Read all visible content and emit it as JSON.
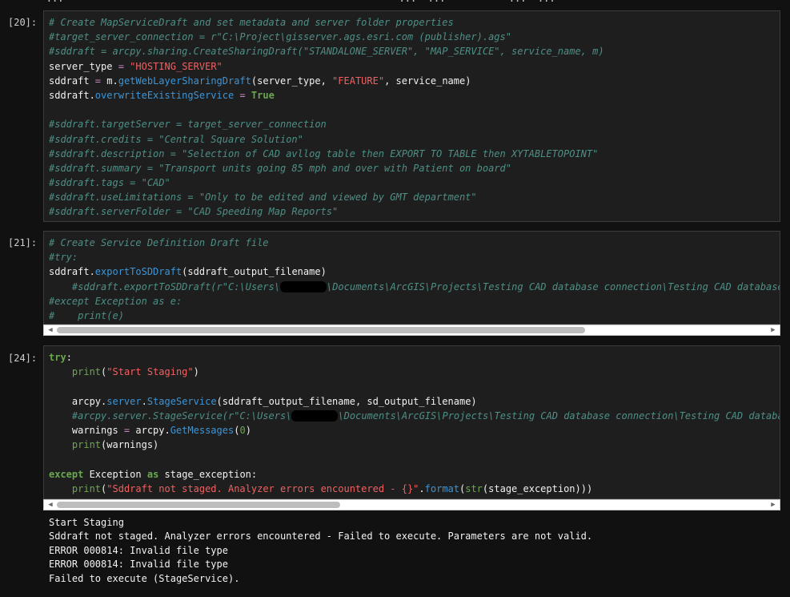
{
  "top_fragment": "        ...                                                          ...  ...           ...  ...",
  "cells": [
    {
      "prompt": "[20]:",
      "lines": [
        [
          [
            "cm",
            "# Create MapServiceDraft and set metadata and server folder properties"
          ]
        ],
        [
          [
            "cm",
            "#target_server_connection = r\"C:\\Project\\gisserver.ags.esri.com (publisher).ags\""
          ]
        ],
        [
          [
            "cm",
            "#sddraft = arcpy.sharing.CreateSharingDraft(\"STANDALONE_SERVER\", \"MAP_SERVICE\", service_name, m)"
          ]
        ],
        [
          [
            "var",
            "server_type "
          ],
          [
            "op",
            "="
          ],
          [
            "var",
            " "
          ],
          [
            "str",
            "\"HOSTING_SERVER\""
          ]
        ],
        [
          [
            "var",
            "sddraft "
          ],
          [
            "op",
            "="
          ],
          [
            "var",
            " m."
          ],
          [
            "fn",
            "getWebLayerSharingDraft"
          ],
          [
            "var",
            "(server_type, "
          ],
          [
            "str",
            "\"FEATURE\""
          ],
          [
            "var",
            ", service_name)"
          ]
        ],
        [
          [
            "var",
            "sddraft."
          ],
          [
            "fn",
            "overwriteExistingService"
          ],
          [
            "var",
            " "
          ],
          [
            "op",
            "="
          ],
          [
            "var",
            " "
          ],
          [
            "kw",
            "True"
          ]
        ],
        [
          [
            "var",
            ""
          ]
        ],
        [
          [
            "cm",
            "#sddraft.targetServer = target_server_connection"
          ]
        ],
        [
          [
            "cm",
            "#sddraft.credits = \"Central Square Solution\""
          ]
        ],
        [
          [
            "cm",
            "#sddraft.description = \"Selection of CAD avllog table then EXPORT TO TABLE then XYTABLETOPOINT\""
          ]
        ],
        [
          [
            "cm",
            "#sddraft.summary = \"Transport units going 85 mph and over with Patient on board\""
          ]
        ],
        [
          [
            "cm",
            "#sddraft.tags = \"CAD\""
          ]
        ],
        [
          [
            "cm",
            "#sddraft.useLimitations = \"Only to be edited and viewed by GMT department\""
          ]
        ],
        [
          [
            "cm",
            "#sddraft.serverFolder = \"CAD Speeding Map Reports\""
          ]
        ]
      ]
    },
    {
      "prompt": "[21]:",
      "lines": [
        [
          [
            "cm",
            "# Create Service Definition Draft file"
          ]
        ],
        [
          [
            "cm",
            "#try:"
          ]
        ],
        [
          [
            "var",
            "sddraft."
          ],
          [
            "fn",
            "exportToSDDraft"
          ],
          [
            "var",
            "(sddraft_output_filename)"
          ]
        ],
        [
          [
            "cm",
            "    #sddraft.exportToSDDraft(r\"C:\\Users\\"
          ],
          [
            "redact",
            ""
          ],
          [
            "cm",
            "\\Documents\\ArcGIS\\Projects\\Testing CAD database connection\\Testing CAD database c"
          ]
        ],
        [
          [
            "cm",
            "#except Exception as e:"
          ]
        ],
        [
          [
            "cm",
            "#    print(e)"
          ]
        ]
      ]
    },
    {
      "prompt": "[24]:",
      "lines": [
        [
          [
            "kw",
            "try"
          ],
          [
            "var",
            ":"
          ]
        ],
        [
          [
            "var",
            "    "
          ],
          [
            "bi",
            "print"
          ],
          [
            "var",
            "("
          ],
          [
            "str",
            "\"Start Staging\""
          ],
          [
            "var",
            ")"
          ]
        ],
        [
          [
            "var",
            ""
          ]
        ],
        [
          [
            "var",
            "    arcpy."
          ],
          [
            "fn",
            "server"
          ],
          [
            "var",
            "."
          ],
          [
            "fn",
            "StageService"
          ],
          [
            "var",
            "(sddraft_output_filename, sd_output_filename)"
          ]
        ],
        [
          [
            "cm",
            "    #arcpy.server.StageService(r\"C:\\Users\\"
          ],
          [
            "redact",
            ""
          ],
          [
            "cm",
            "\\Documents\\ArcGIS\\Projects\\Testing CAD database connection\\Testing CAD database"
          ]
        ],
        [
          [
            "var",
            "    warnings "
          ],
          [
            "op",
            "="
          ],
          [
            "var",
            " arcpy."
          ],
          [
            "fn",
            "GetMessages"
          ],
          [
            "var",
            "("
          ],
          [
            "num",
            "0"
          ],
          [
            "var",
            ")"
          ]
        ],
        [
          [
            "var",
            "    "
          ],
          [
            "bi",
            "print"
          ],
          [
            "var",
            "(warnings)"
          ]
        ],
        [
          [
            "var",
            ""
          ]
        ],
        [
          [
            "kw",
            "except"
          ],
          [
            "var",
            " Exception "
          ],
          [
            "kw",
            "as"
          ],
          [
            "var",
            " stage_exception:"
          ]
        ],
        [
          [
            "var",
            "    "
          ],
          [
            "bi",
            "print"
          ],
          [
            "var",
            "("
          ],
          [
            "str",
            "\"Sddraft not staged. Analyzer errors encountered - {}\""
          ],
          [
            "var",
            "."
          ],
          [
            "fn",
            "format"
          ],
          [
            "var",
            "("
          ],
          [
            "bi",
            "str"
          ],
          [
            "var",
            "(stage_exception)))"
          ]
        ]
      ]
    }
  ],
  "output_lines": [
    "Start Staging",
    "Sddraft not staged. Analyzer errors encountered - Failed to execute. Parameters are not valid.",
    "ERROR 000814: Invalid file type",
    "ERROR 000814: Invalid file type",
    "Failed to execute (StageService)."
  ],
  "colors": {
    "background": "#111111",
    "cell_background": "#1e1e1e",
    "comment": "#4e8f86",
    "keyword": "#6aa84f",
    "string": "#f06060",
    "function": "#3d95d6"
  }
}
